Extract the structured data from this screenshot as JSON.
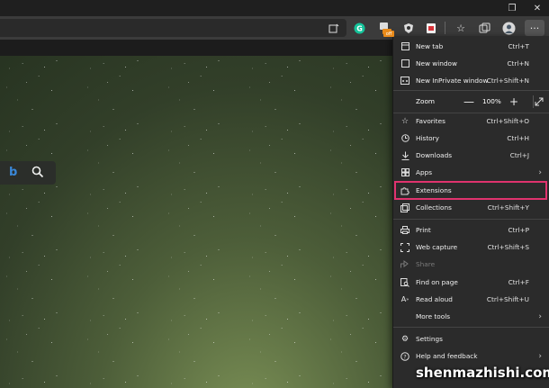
{
  "window_controls": {
    "restore": "❐",
    "close": "✕"
  },
  "toolbar_icons": [
    "reading-view-icon",
    "grammarly-icon",
    "coupon-icon",
    "shield-extension-icon",
    "pdf-extension-icon",
    "favorites-icon",
    "collections-icon",
    "profile-avatar-icon",
    "more-menu-icon"
  ],
  "toolbar_badge": "off",
  "toolbar_more": "···",
  "menu": {
    "items": [
      {
        "label": "New tab",
        "shortcut": "Ctrl+T"
      },
      {
        "label": "New window",
        "shortcut": "Ctrl+N"
      },
      {
        "label": "New InPrivate window",
        "shortcut": "Ctrl+Shift+N"
      },
      {
        "label": "Favorites",
        "shortcut": "Ctrl+Shift+O"
      },
      {
        "label": "History",
        "shortcut": "Ctrl+H"
      },
      {
        "label": "Downloads",
        "shortcut": "Ctrl+J"
      },
      {
        "label": "Apps",
        "shortcut": ""
      },
      {
        "label": "Extensions",
        "shortcut": ""
      },
      {
        "label": "Collections",
        "shortcut": "Ctrl+Shift+Y"
      },
      {
        "label": "Print",
        "shortcut": "Ctrl+P"
      },
      {
        "label": "Web capture",
        "shortcut": "Ctrl+Shift+S"
      },
      {
        "label": "Share",
        "shortcut": ""
      },
      {
        "label": "Find on page",
        "shortcut": "Ctrl+F"
      },
      {
        "label": "Read aloud",
        "shortcut": "Ctrl+Shift+U"
      },
      {
        "label": "More tools",
        "shortcut": ""
      },
      {
        "label": "Settings",
        "shortcut": ""
      },
      {
        "label": "Help and feedback",
        "shortcut": ""
      }
    ],
    "zoom": {
      "label": "Zoom",
      "value": "100%",
      "minus": "—",
      "plus": "+"
    }
  },
  "highlight_color": "#e0336e",
  "watermark": "shenmazhishi.com"
}
